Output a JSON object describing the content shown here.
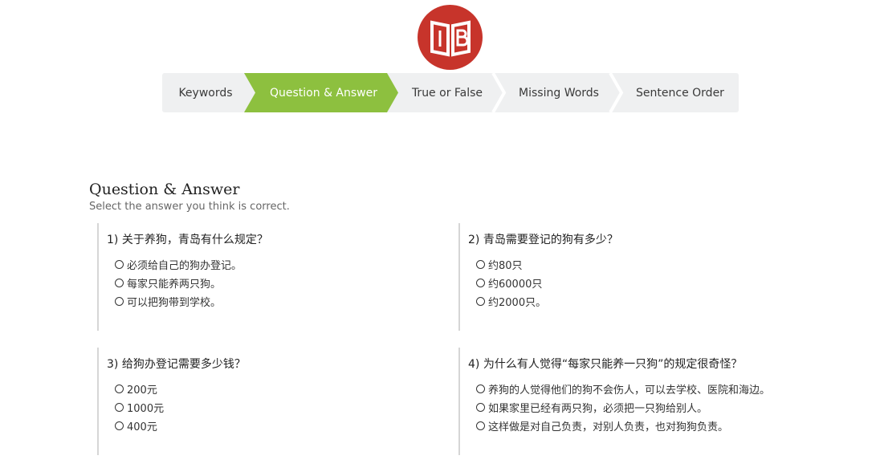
{
  "colors": {
    "accent": "#8dc03f",
    "logo_red": "#c7342b",
    "nav_bg": "#eff0f1"
  },
  "logo": {
    "icon": "book-logo-icon",
    "lettering": "CtB"
  },
  "nav": {
    "steps": [
      {
        "label": "Keywords",
        "active": false
      },
      {
        "label": "Question & Answer",
        "active": true
      },
      {
        "label": "True or False",
        "active": false
      },
      {
        "label": "Missing Words",
        "active": false
      },
      {
        "label": "Sentence Order",
        "active": false
      }
    ]
  },
  "section": {
    "title": "Question & Answer",
    "subtitle": "Select the answer you think is correct."
  },
  "questions": [
    {
      "text": "1) 关于养狗，青岛有什么规定？",
      "options": [
        "必须给自己的狗办登记。",
        "每家只能养两只狗。",
        "可以把狗带到学校。"
      ]
    },
    {
      "text": "2) 青岛需要登记的狗有多少？",
      "options": [
        "约80只",
        "约60000只",
        "约2000只。"
      ]
    },
    {
      "text": "3) 给狗办登记需要多少钱？",
      "options": [
        "200元",
        "1000元",
        "400元"
      ]
    },
    {
      "text": "4) 为什么有人觉得“每家只能养一只狗”的规定很奇怪？",
      "options": [
        "养狗的人觉得他们的狗不会伤人，可以去学校、医院和海边。",
        "如果家里已经有两只狗，必须把一只狗给别人。",
        "这样做是对自己负责，对别人负责，也对狗狗负责。"
      ]
    }
  ]
}
